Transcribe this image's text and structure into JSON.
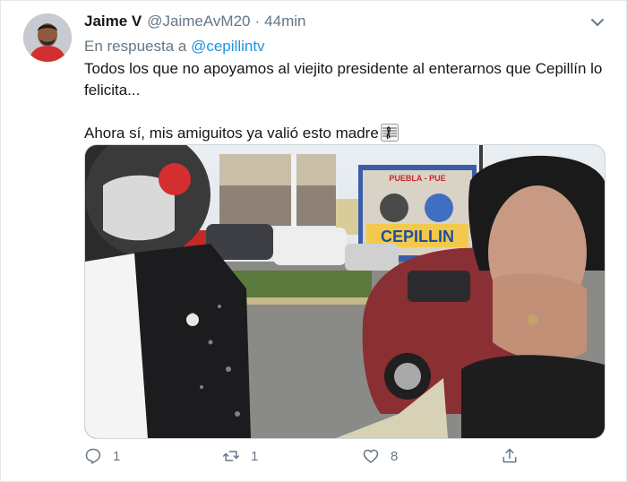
{
  "tweet": {
    "name": "Jaime V",
    "handle": "@JaimeAvM20",
    "separator": "·",
    "time": "44min",
    "reply_prefix": "En respuesta a",
    "reply_handle": "@cepillintv",
    "text_line1": "Todos los que no apoyamos al viejito presidente al enterarnos que Cepillín lo felicita...",
    "text_line2": "Ahora sí, mis amiguitos ya valió esto madre",
    "emoji": "music-score-icon"
  },
  "media": {
    "sign_top": "PUEBLA - PUE",
    "sign_main": "CEPILLIN"
  },
  "actions": {
    "reply_count": "1",
    "retweet_count": "1",
    "like_count": "8"
  },
  "colors": {
    "link": "#1b95e0",
    "secondary_text": "#657786",
    "border": "#e1e8ed"
  }
}
